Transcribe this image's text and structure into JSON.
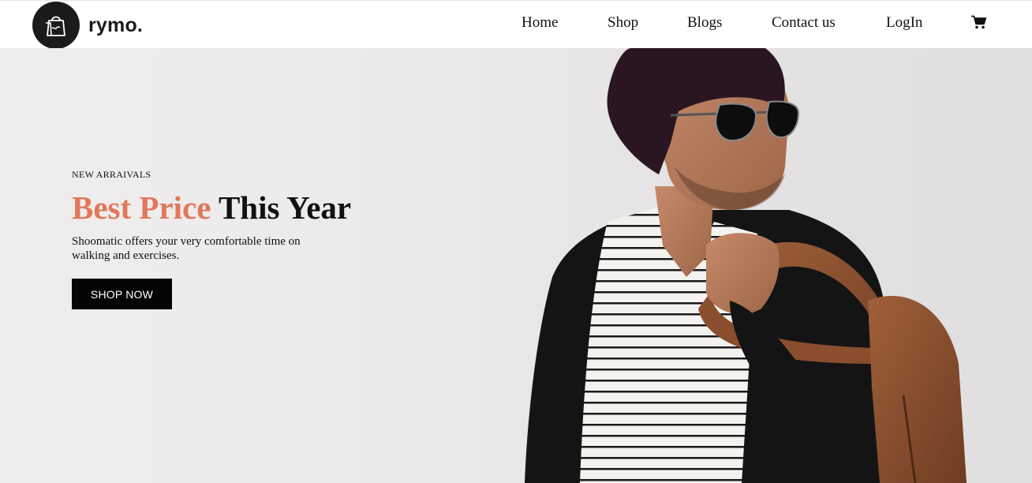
{
  "brand": {
    "name": "rymo.",
    "logo_icon": "shopping-bag-icon",
    "logo_bg_color": "#1b1b1b"
  },
  "nav": {
    "items": [
      {
        "label": "Home"
      },
      {
        "label": "Shop"
      },
      {
        "label": "Blogs"
      },
      {
        "label": "Contact us"
      },
      {
        "label": "LogIn"
      }
    ],
    "cart_icon": "cart-icon"
  },
  "hero": {
    "eyebrow": "NEW ARRAIVALS",
    "headline_accent": "Best Price",
    "headline_rest": " This Year",
    "description": "Shoomatic offers your very comfortable time on walking and exercises.",
    "cta_label": "SHOP NOW",
    "accent_color": "#e2775a",
    "cta_bg_color": "#050505"
  }
}
